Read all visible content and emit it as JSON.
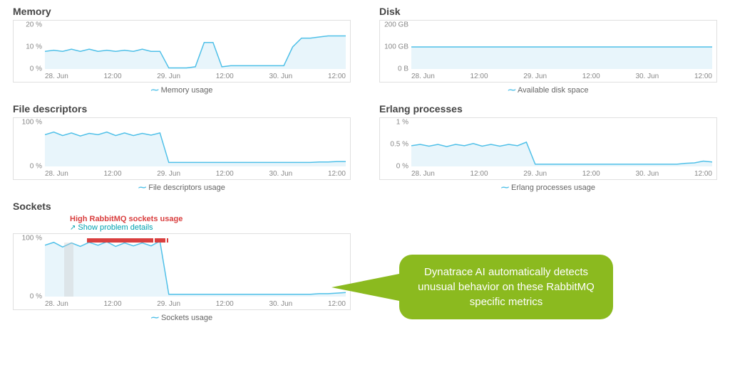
{
  "chart_data": [
    {
      "id": "memory",
      "type": "area",
      "title": "Memory",
      "legend": "Memory usage",
      "ylim": [
        0,
        20
      ],
      "yunit": "%",
      "yticks": [
        0,
        10,
        20
      ],
      "x_labels": [
        "28. Jun",
        "12:00",
        "29. Jun",
        "12:00",
        "30. Jun",
        "12:00"
      ],
      "values": [
        8,
        8.5,
        8,
        9,
        8,
        9,
        8,
        8.5,
        8,
        8.5,
        8,
        9,
        8,
        8,
        0.5,
        0.5,
        0.5,
        1,
        12,
        12,
        1,
        1.5,
        1.5,
        1.5,
        1.5,
        1.5,
        1.5,
        1.5,
        10,
        14,
        14,
        14.5,
        15,
        15,
        15
      ]
    },
    {
      "id": "disk",
      "type": "area",
      "title": "Disk",
      "legend": "Available disk space",
      "ylim": [
        0,
        200
      ],
      "yunit": "GB",
      "yticks": [
        "0 B",
        "100 GB",
        "200 GB"
      ],
      "x_labels": [
        "28. Jun",
        "12:00",
        "29. Jun",
        "12:00",
        "30. Jun",
        "12:00"
      ],
      "values": [
        100,
        100,
        100,
        100,
        100,
        100,
        100,
        100,
        100,
        100,
        100,
        100,
        100,
        100,
        100,
        100,
        100,
        100,
        100,
        100,
        100,
        100,
        100,
        100,
        100,
        100,
        100,
        100,
        100,
        100,
        100,
        100,
        100,
        100,
        100
      ]
    },
    {
      "id": "fd",
      "type": "area",
      "title": "File descriptors",
      "legend": "File descriptors usage",
      "ylim": [
        0,
        100
      ],
      "yunit": "%",
      "yticks": [
        0,
        100
      ],
      "x_labels": [
        "28. Jun",
        "12:00",
        "29. Jun",
        "12:00",
        "30. Jun",
        "12:00"
      ],
      "values": [
        72,
        78,
        70,
        76,
        69,
        75,
        72,
        78,
        70,
        76,
        70,
        75,
        71,
        76,
        9,
        9,
        9,
        9,
        9,
        9,
        9,
        9,
        9,
        9,
        9,
        9,
        9,
        9,
        9,
        9,
        9,
        10,
        10,
        11,
        11
      ]
    },
    {
      "id": "erlang",
      "type": "area",
      "title": "Erlang processes",
      "legend": "Erlang processes usage",
      "ylim": [
        0,
        1
      ],
      "yunit": "%",
      "yticks": [
        0,
        0.5,
        1
      ],
      "x_labels": [
        "28. Jun",
        "12:00",
        "29. Jun",
        "12:00",
        "30. Jun",
        "12:00"
      ],
      "values": [
        0.47,
        0.5,
        0.46,
        0.5,
        0.45,
        0.5,
        0.47,
        0.52,
        0.46,
        0.5,
        0.46,
        0.5,
        0.47,
        0.55,
        0.05,
        0.05,
        0.05,
        0.05,
        0.05,
        0.05,
        0.05,
        0.05,
        0.05,
        0.05,
        0.05,
        0.05,
        0.05,
        0.05,
        0.05,
        0.05,
        0.05,
        0.07,
        0.08,
        0.12,
        0.1
      ]
    },
    {
      "id": "sockets",
      "type": "area",
      "title": "Sockets",
      "legend": "Sockets usage",
      "ylim": [
        0,
        100
      ],
      "yunit": "%",
      "yticks": [
        0,
        100
      ],
      "x_labels": [
        "28. Jun",
        "12:00",
        "29. Jun",
        "12:00",
        "30. Jun",
        "12:00"
      ],
      "values": [
        88,
        93,
        85,
        92,
        86,
        93,
        88,
        94,
        86,
        92,
        87,
        92,
        87,
        95,
        4,
        4,
        4,
        4,
        4,
        4,
        4,
        4,
        4,
        4,
        4,
        4,
        4,
        4,
        4,
        4,
        4,
        5,
        5,
        6,
        7
      ],
      "alert": {
        "label": "High RabbitMQ sockets usage",
        "link": "Show problem details",
        "bar_segments": [
          [
            0.14,
            0.36
          ],
          [
            0.365,
            0.4
          ],
          [
            0.405,
            0.41
          ]
        ],
        "highlight": [
          0.065,
          0.095
        ]
      }
    }
  ],
  "callout": {
    "text": "Dynatrace AI automatically detects unusual behavior on these RabbitMQ specific metrics"
  },
  "colors": {
    "line": "#4fc0e8",
    "fill": "#e8f5fb"
  }
}
